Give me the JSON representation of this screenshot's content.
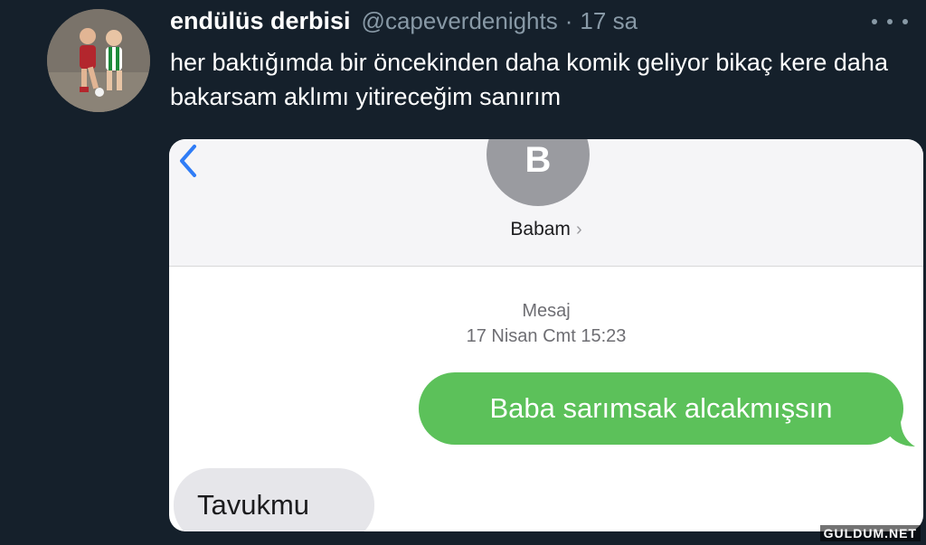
{
  "tweet": {
    "display_name": "endülüs derbisi",
    "handle": "@capeverdenights",
    "separator": "·",
    "time": "17 sa",
    "text": "her baktığımda bir öncekinden daha komik geliyor bikaç kere daha bakarsam aklımı yitireceğim sanırım",
    "avatar_icon": "avatar-photo-two-children-playing-football",
    "more_icon": "more-horizontal-icon"
  },
  "media": {
    "back_icon": "chevron-left-icon",
    "contact_initial": "B",
    "contact_name": "Babam",
    "contact_chevron": "›",
    "meta_line1": "Mesaj",
    "meta_line2": "17 Nisan Cmt 15:23",
    "outgoing_message": "Baba sarımsak alcakmışsın",
    "incoming_message": "Tavukmu",
    "outgoing_color": "#5cc15a",
    "incoming_color": "#e6e6ea"
  },
  "watermark": "GULDUM.NET",
  "colors": {
    "background": "#15202b",
    "secondary_text": "#8899a6",
    "ios_blue": "#2f7cf6"
  }
}
